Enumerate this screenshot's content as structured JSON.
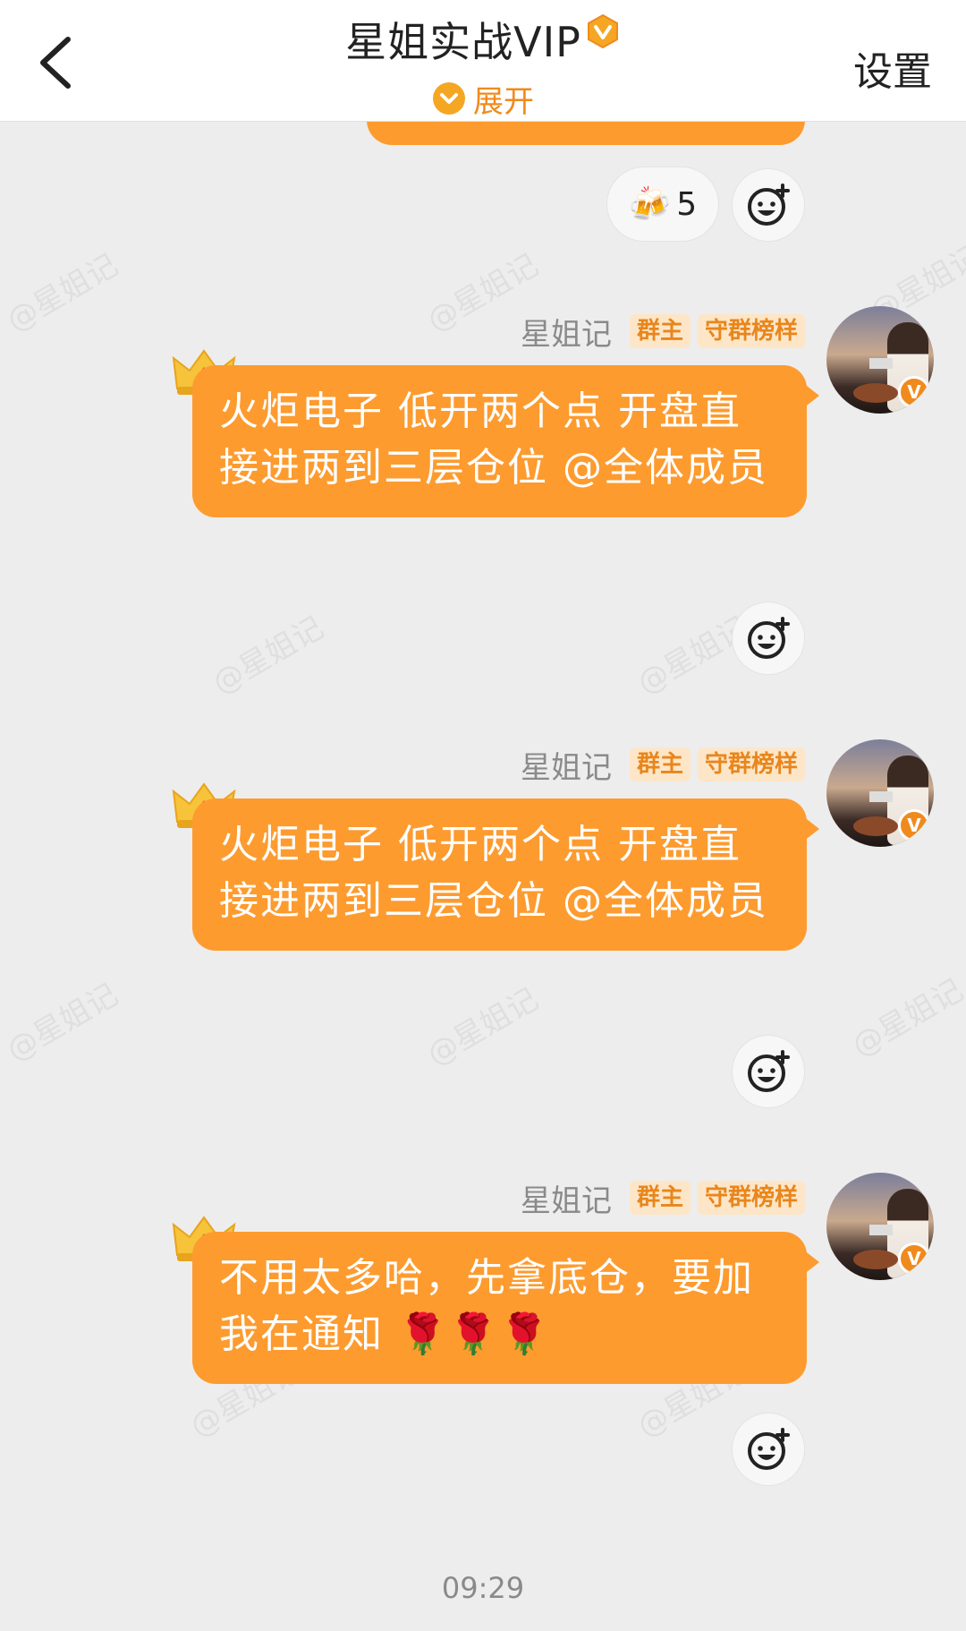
{
  "header": {
    "title": "星姐实战VIP",
    "expand_label": "展开",
    "settings_label": "设置"
  },
  "watermark_text": "@星姐记",
  "reactions": {
    "emoji": "🍻",
    "count": "5"
  },
  "messages": [
    {
      "sender": "星姐记",
      "tags": [
        "群主",
        "守群榜样"
      ],
      "text": "火炬电子  低开两个点   开盘直接进两到三层仓位   @全体成员"
    },
    {
      "sender": "星姐记",
      "tags": [
        "群主",
        "守群榜样"
      ],
      "text": "火炬电子  低开两个点   开盘直接进两到三层仓位   @全体成员"
    },
    {
      "sender": "星姐记",
      "tags": [
        "群主",
        "守群榜样"
      ],
      "text": "不用太多哈，先拿底仓，要加我在通知 🌹🌹🌹"
    }
  ],
  "timestamp": "09:29",
  "colors": {
    "accent": "#f08a1c",
    "bubble": "#fd9b2f",
    "background": "#ededed"
  }
}
